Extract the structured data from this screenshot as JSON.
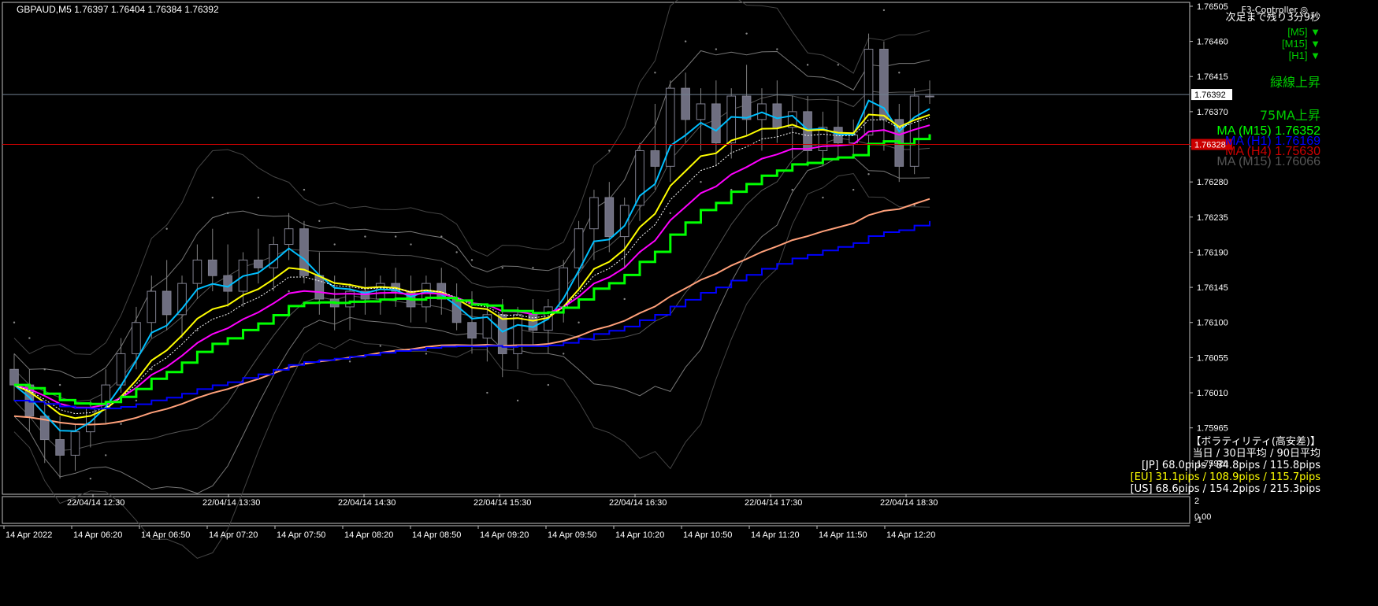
{
  "header": {
    "symbol_line": "GBPAUD,M5  1.76397 1.76404 1.76384 1.76392",
    "controller": "F3-Controller",
    "countdown": "次足まで残り3分9秒"
  },
  "signals": {
    "tf": [
      {
        "label": "[M5]",
        "arrow": "▼"
      },
      {
        "label": "[M15]",
        "arrow": "▼"
      },
      {
        "label": "[H1]",
        "arrow": "▼"
      }
    ],
    "status1": "緑線上昇",
    "status2": "75MA上昇",
    "ma_lines": [
      {
        "text": "MA (M15)  1.76352",
        "color": "#00ff00"
      },
      {
        "text": "MA (H1)  1.76169",
        "color": "#0000ff"
      },
      {
        "text": "MA (H4)  1.75630",
        "color": "#cc0000"
      },
      {
        "text": "MA (M15)  1.76066",
        "color": "#555555"
      }
    ]
  },
  "volatility": {
    "title": "【ボラティリティ(高安差)】",
    "header": "当日 / 30日平均 / 90日平均",
    "rows": [
      {
        "text": "[JP] 68.0pips / 84.8pips / 115.8pips",
        "color": "#ffffff"
      },
      {
        "text": "[EU] 31.1pips / 108.9pips / 115.7pips",
        "color": "#ffff00"
      },
      {
        "text": "[US] 68.6pips / 154.2pips / 215.3pips",
        "color": "#ffffff"
      }
    ]
  },
  "price_axis": {
    "labels": [
      "1.76505",
      "1.76460",
      "1.76415",
      "1.76370",
      "1.76325",
      "1.76280",
      "1.76235",
      "1.76190",
      "1.76145",
      "1.76100",
      "1.76055",
      "1.76010",
      "1.75965",
      "1.75920"
    ],
    "current_price": "1.76392",
    "alert_price": "1.76328"
  },
  "sub_axis": {
    "top": "2",
    "mid": "0.00",
    "bottom": "-1"
  },
  "upper_time_labels": [
    "22/04/14 12:30",
    "22/04/14 13:30",
    "22/04/14 14:30",
    "22/04/14 15:30",
    "22/04/14 16:30",
    "22/04/14 17:30",
    "22/04/14 18:30"
  ],
  "bottom_time_labels": [
    "14 Apr 2022",
    "14 Apr 06:20",
    "14 Apr 06:50",
    "14 Apr 07:20",
    "14 Apr 07:50",
    "14 Apr 08:20",
    "14 Apr 08:50",
    "14 Apr 09:20",
    "14 Apr 09:50",
    "14 Apr 10:20",
    "14 Apr 10:50",
    "14 Apr 11:20",
    "14 Apr 11:50",
    "14 Apr 12:20"
  ],
  "chart_data": {
    "type": "candlestick",
    "ylim": [
      1.7588,
      1.7651
    ],
    "candles": [
      {
        "o": 1.7604,
        "h": 1.7606,
        "l": 1.76,
        "c": 1.7602
      },
      {
        "o": 1.7602,
        "h": 1.7604,
        "l": 1.7596,
        "c": 1.7598
      },
      {
        "o": 1.7598,
        "h": 1.76,
        "l": 1.7592,
        "c": 1.7595
      },
      {
        "o": 1.7595,
        "h": 1.7598,
        "l": 1.759,
        "c": 1.7593
      },
      {
        "o": 1.7593,
        "h": 1.7597,
        "l": 1.7591,
        "c": 1.7596
      },
      {
        "o": 1.7596,
        "h": 1.76,
        "l": 1.7594,
        "c": 1.7599
      },
      {
        "o": 1.7599,
        "h": 1.7604,
        "l": 1.7597,
        "c": 1.7602
      },
      {
        "o": 1.7602,
        "h": 1.7608,
        "l": 1.7601,
        "c": 1.7606
      },
      {
        "o": 1.7606,
        "h": 1.7612,
        "l": 1.7604,
        "c": 1.761
      },
      {
        "o": 1.761,
        "h": 1.7616,
        "l": 1.7608,
        "c": 1.7614
      },
      {
        "o": 1.7614,
        "h": 1.7618,
        "l": 1.7609,
        "c": 1.7611
      },
      {
        "o": 1.7611,
        "h": 1.7616,
        "l": 1.7608,
        "c": 1.7615
      },
      {
        "o": 1.7615,
        "h": 1.762,
        "l": 1.7613,
        "c": 1.7618
      },
      {
        "o": 1.7618,
        "h": 1.7622,
        "l": 1.7614,
        "c": 1.7616
      },
      {
        "o": 1.7616,
        "h": 1.762,
        "l": 1.7612,
        "c": 1.7614
      },
      {
        "o": 1.7614,
        "h": 1.7619,
        "l": 1.7612,
        "c": 1.7618
      },
      {
        "o": 1.7618,
        "h": 1.7622,
        "l": 1.7615,
        "c": 1.7617
      },
      {
        "o": 1.7617,
        "h": 1.7621,
        "l": 1.7614,
        "c": 1.762
      },
      {
        "o": 1.762,
        "h": 1.7624,
        "l": 1.7618,
        "c": 1.7622
      },
      {
        "o": 1.7622,
        "h": 1.7623,
        "l": 1.7615,
        "c": 1.7616
      },
      {
        "o": 1.7616,
        "h": 1.7619,
        "l": 1.7611,
        "c": 1.7613
      },
      {
        "o": 1.7613,
        "h": 1.7616,
        "l": 1.7609,
        "c": 1.7612
      },
      {
        "o": 1.7612,
        "h": 1.7615,
        "l": 1.7609,
        "c": 1.7614
      },
      {
        "o": 1.7614,
        "h": 1.7617,
        "l": 1.7611,
        "c": 1.7613
      },
      {
        "o": 1.7613,
        "h": 1.7616,
        "l": 1.7611,
        "c": 1.7615
      },
      {
        "o": 1.7615,
        "h": 1.7617,
        "l": 1.7612,
        "c": 1.7614
      },
      {
        "o": 1.7614,
        "h": 1.7616,
        "l": 1.761,
        "c": 1.7612
      },
      {
        "o": 1.7612,
        "h": 1.7616,
        "l": 1.761,
        "c": 1.7615
      },
      {
        "o": 1.7615,
        "h": 1.7617,
        "l": 1.7611,
        "c": 1.7613
      },
      {
        "o": 1.7613,
        "h": 1.7615,
        "l": 1.7609,
        "c": 1.761
      },
      {
        "o": 1.761,
        "h": 1.7614,
        "l": 1.7606,
        "c": 1.7608
      },
      {
        "o": 1.7608,
        "h": 1.7612,
        "l": 1.7605,
        "c": 1.7611
      },
      {
        "o": 1.7611,
        "h": 1.7613,
        "l": 1.7603,
        "c": 1.7606
      },
      {
        "o": 1.7606,
        "h": 1.7612,
        "l": 1.7604,
        "c": 1.7611
      },
      {
        "o": 1.7611,
        "h": 1.7613,
        "l": 1.7607,
        "c": 1.7609
      },
      {
        "o": 1.7609,
        "h": 1.7613,
        "l": 1.7606,
        "c": 1.7612
      },
      {
        "o": 1.7612,
        "h": 1.7618,
        "l": 1.761,
        "c": 1.7617
      },
      {
        "o": 1.7617,
        "h": 1.7623,
        "l": 1.7614,
        "c": 1.7622
      },
      {
        "o": 1.7622,
        "h": 1.7627,
        "l": 1.7618,
        "c": 1.7626
      },
      {
        "o": 1.7626,
        "h": 1.7628,
        "l": 1.7619,
        "c": 1.7621
      },
      {
        "o": 1.7621,
        "h": 1.7626,
        "l": 1.7617,
        "c": 1.7625
      },
      {
        "o": 1.7625,
        "h": 1.7633,
        "l": 1.7623,
        "c": 1.7632
      },
      {
        "o": 1.7632,
        "h": 1.7638,
        "l": 1.7627,
        "c": 1.763
      },
      {
        "o": 1.763,
        "h": 1.7641,
        "l": 1.7628,
        "c": 1.764
      },
      {
        "o": 1.764,
        "h": 1.7642,
        "l": 1.7633,
        "c": 1.7636
      },
      {
        "o": 1.7636,
        "h": 1.764,
        "l": 1.7632,
        "c": 1.7638
      },
      {
        "o": 1.7638,
        "h": 1.7641,
        "l": 1.763,
        "c": 1.7633
      },
      {
        "o": 1.7633,
        "h": 1.764,
        "l": 1.7631,
        "c": 1.7639
      },
      {
        "o": 1.7639,
        "h": 1.7643,
        "l": 1.7634,
        "c": 1.7636
      },
      {
        "o": 1.7636,
        "h": 1.764,
        "l": 1.7632,
        "c": 1.7638
      },
      {
        "o": 1.7638,
        "h": 1.7641,
        "l": 1.7633,
        "c": 1.7635
      },
      {
        "o": 1.7635,
        "h": 1.7639,
        "l": 1.7631,
        "c": 1.7637
      },
      {
        "o": 1.7637,
        "h": 1.7639,
        "l": 1.763,
        "c": 1.7632
      },
      {
        "o": 1.7632,
        "h": 1.7637,
        "l": 1.763,
        "c": 1.7635
      },
      {
        "o": 1.7635,
        "h": 1.7639,
        "l": 1.7631,
        "c": 1.7633
      },
      {
        "o": 1.7633,
        "h": 1.7636,
        "l": 1.7631,
        "c": 1.7634
      },
      {
        "o": 1.7634,
        "h": 1.7647,
        "l": 1.7633,
        "c": 1.7645
      },
      {
        "o": 1.7645,
        "h": 1.7646,
        "l": 1.7632,
        "c": 1.7636
      },
      {
        "o": 1.7636,
        "h": 1.7638,
        "l": 1.7628,
        "c": 1.763
      },
      {
        "o": 1.763,
        "h": 1.764,
        "l": 1.7629,
        "c": 1.7639
      },
      {
        "o": 1.7639,
        "h": 1.7641,
        "l": 1.7638,
        "c": 1.7639
      }
    ]
  }
}
